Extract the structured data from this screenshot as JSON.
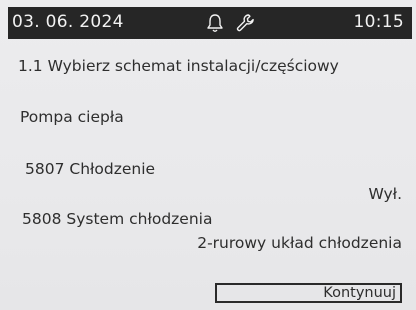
{
  "status_bar": {
    "date": "03. 06. 2024",
    "time": "10:15",
    "icons": [
      "bell-icon",
      "wrench-icon"
    ]
  },
  "screen": {
    "title": "1.1 Wybierz schemat instalacji/częściowy",
    "section": "Pompa ciepła",
    "parameters": [
      {
        "label": "5807 Chłodzenie",
        "value": "Wył."
      },
      {
        "label": "5808 System chłodzenia",
        "value": "2-rurowy układ chłodzenia"
      }
    ]
  },
  "actions": {
    "continue_label": "Kontynuuj"
  }
}
